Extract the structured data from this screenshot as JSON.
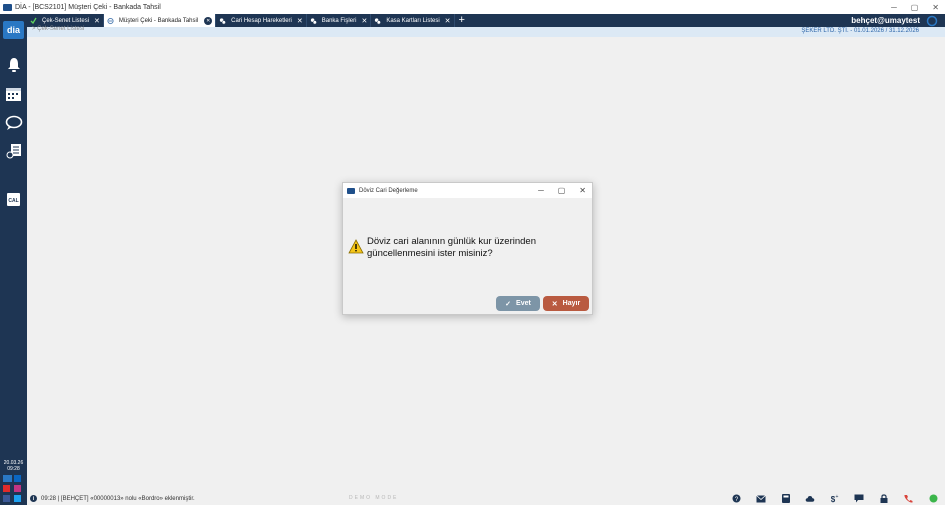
{
  "window": {
    "title": "DİA - [BCS2101] Müşteri Çeki - Bankada Tahsil"
  },
  "tabs": [
    {
      "label": "Çek-Senet Listesi",
      "icon": "check-icon"
    },
    {
      "label": "Müşteri Çeki - Bankada Tahsil",
      "icon": "cheque-icon",
      "active": true
    },
    {
      "label": "Cari Hesap Hareketleri",
      "icon": "link-icon"
    },
    {
      "label": "Banka Fişleri",
      "icon": "link-icon"
    },
    {
      "label": "Kasa Kartları Listesi",
      "icon": "link-icon"
    }
  ],
  "header": {
    "user": "behçet@umaytest",
    "company": "ŞEKER LTD. ŞTİ. - 01.01.2026 / 31.12.2026",
    "breadcrumb": "> Çek-Senet Listesi"
  },
  "sidebar": {
    "logo": "dia",
    "icons": [
      "bell-icon",
      "calendar-icon",
      "chat-icon",
      "report-icon",
      "calculator-icon"
    ],
    "date": "20.03.26",
    "time": "09:28"
  },
  "dialog": {
    "title": "Döviz Cari Değerleme",
    "message": "Döviz cari alanının günlük kur üzerinden güncellenmesini ister misiniz?",
    "yes_label": "Evet",
    "no_label": "Hayır"
  },
  "statusbar": {
    "message": "09:28 | [BEHÇET] «00000013» nolu «Bordro» eklenmiştir.",
    "demo_mode": "DEMO MODE"
  },
  "colors": {
    "sidebar": "#1e3553",
    "infobar": "#dce9f5",
    "yes_button": "#7d95a7",
    "no_button": "#b95a40"
  }
}
